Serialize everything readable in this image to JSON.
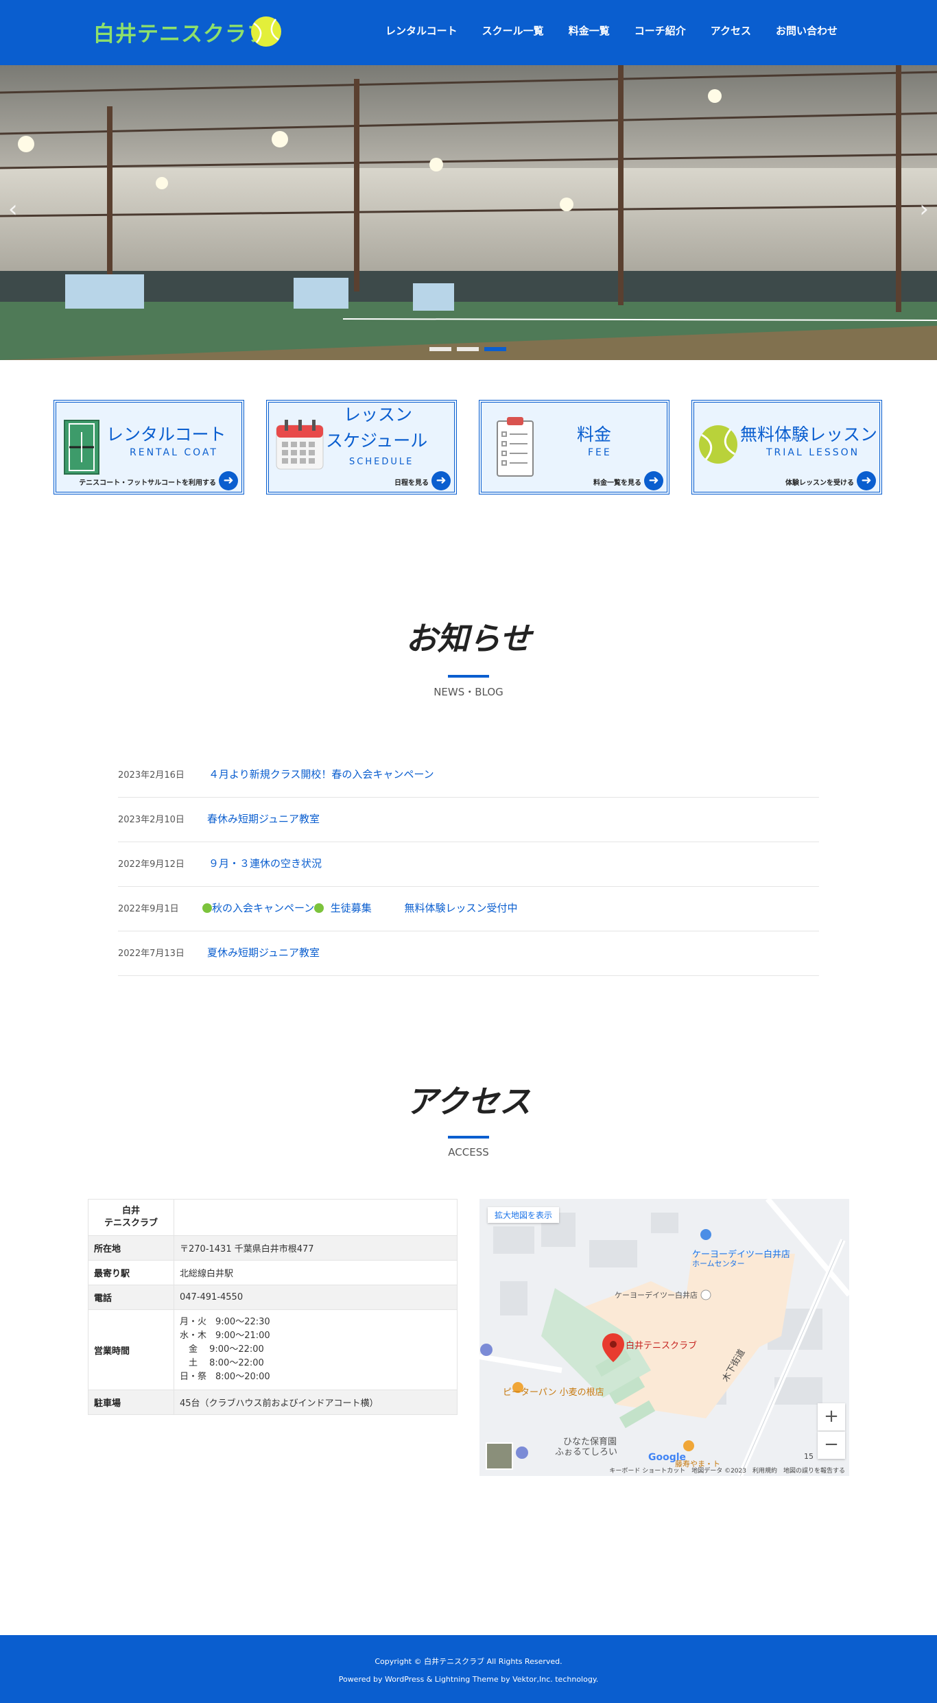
{
  "header": {
    "logo_text": "白井テニスクラブ",
    "nav": [
      "レンタルコート",
      "スクール一覧",
      "料金一覧",
      "コーチ紹介",
      "アクセス",
      "お問い合わせ"
    ]
  },
  "hero": {
    "prev_icon": "chevron-left",
    "next_icon": "chevron-right",
    "slides": 3,
    "active_slide": 3
  },
  "banners": [
    {
      "title": "レンタルコート",
      "sub": "RENTAL COAT",
      "foot": "テニスコート・フットサルコートを利用する",
      "icon": "court-icon"
    },
    {
      "title": "レッスン\nスケジュール",
      "title1": "レッスン",
      "title2": "スケジュール",
      "sub": "SCHEDULE",
      "foot": "日程を見る",
      "icon": "calendar-icon"
    },
    {
      "title": "料金",
      "sub": "FEE",
      "foot": "料金一覧を見る",
      "icon": "clipboard-icon"
    },
    {
      "title": "無料体験レッスン",
      "sub": "TRIAL LESSON",
      "foot": "体験レッスンを受ける",
      "icon": "tennis-ball-icon"
    }
  ],
  "news": {
    "title": "お知らせ",
    "subtitle": "NEWS・BLOG",
    "items": [
      {
        "date": "2023年2月16日",
        "title": "４月より新規クラス開校！春の入会キャンペーン"
      },
      {
        "date": "2023年2月10日",
        "title": "春休み短期ジュニア教室"
      },
      {
        "date": "2022年9月12日",
        "title": "９月・３連休の空き状況"
      },
      {
        "date": "2022年9月1日",
        "title_a": "秋の入会キャンペーン",
        "title_b": "  生徒募集          無料体験レッスン受付中"
      },
      {
        "date": "2022年7月13日",
        "title": "夏休み短期ジュニア教室"
      }
    ]
  },
  "access": {
    "title": "アクセス",
    "subtitle": "ACCESS",
    "table": {
      "name": "白井\nテニスクラブ",
      "rows": [
        {
          "label": "所在地",
          "value": "〒270-1431 千葉県白井市根477"
        },
        {
          "label": "最寄り駅",
          "value": "北総線白井駅"
        },
        {
          "label": "電話",
          "value": "047-491-4550"
        },
        {
          "label": "営業時間",
          "value": "月・火　9:00～22:30\n水・木　9:00～21:00\n　金　 9:00～22:00\n　土　 8:00～22:00\n日・祭　8:00～20:00"
        },
        {
          "label": "駐車場",
          "value": "45台（クラブハウス前およびインドアコート横）"
        }
      ]
    },
    "map": {
      "enlarge": "拡大地図を表示",
      "labels": {
        "keiyo": "ケーヨーデイツー白井店",
        "keiyo_sub": "ホームセンター",
        "keiyo2": "ケーヨーデイツー白井店",
        "club": "白井テニスクラブ",
        "bakery": "ピーターパン 小麦の根店",
        "road": "木下街道",
        "nursery": "ひなた保育園",
        "nursery2": "ふぉるてしろい",
        "restaurant": "藤寿やま・ト"
      },
      "zoom_in": "+",
      "zoom_out": "−",
      "scale": "15",
      "google": "Google",
      "footer": "キーボード ショートカット　地図データ ©2023　利用規約　地図の誤りを報告する"
    }
  },
  "footer": {
    "copyright": "Copyright © 白井テニスクラブ All Rights Reserved.",
    "powered": "Powered by WordPress & Lightning Theme by Vektor,Inc. technology."
  },
  "colors": {
    "brand": "#0a5ecf",
    "logo": "#8ee06b",
    "banner_bg": "#eaf4fe"
  }
}
